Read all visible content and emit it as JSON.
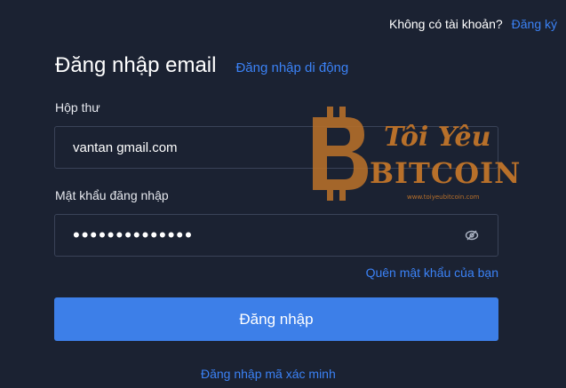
{
  "header": {
    "no_account_text": "Không có tài khoản?",
    "register_link": "Đăng ký"
  },
  "form": {
    "title": "Đăng nhập email",
    "mobile_login_link": "Đăng nhập di động",
    "email_label": "Hộp thư",
    "email_value": "vantan gmail.com",
    "password_label": "Mật khẩu đăng nhập",
    "password_value": "••••••••••••••",
    "forgot_link": "Quên mật khẩu của bạn",
    "submit_label": "Đăng nhập",
    "code_login_link": "Đăng nhập mã xác minh"
  },
  "watermark": {
    "brand_line1": "Tôi Yêu",
    "brand_line2": "BITCOIN",
    "site": "www.toiyeubitcoin.com"
  },
  "colors": {
    "background": "#1b2232",
    "accent": "#3d7fe8",
    "link": "#3b82f6",
    "border": "#3a4358",
    "watermark": "#b8702a"
  },
  "icons": {
    "password_toggle": "eye-slash-icon"
  }
}
